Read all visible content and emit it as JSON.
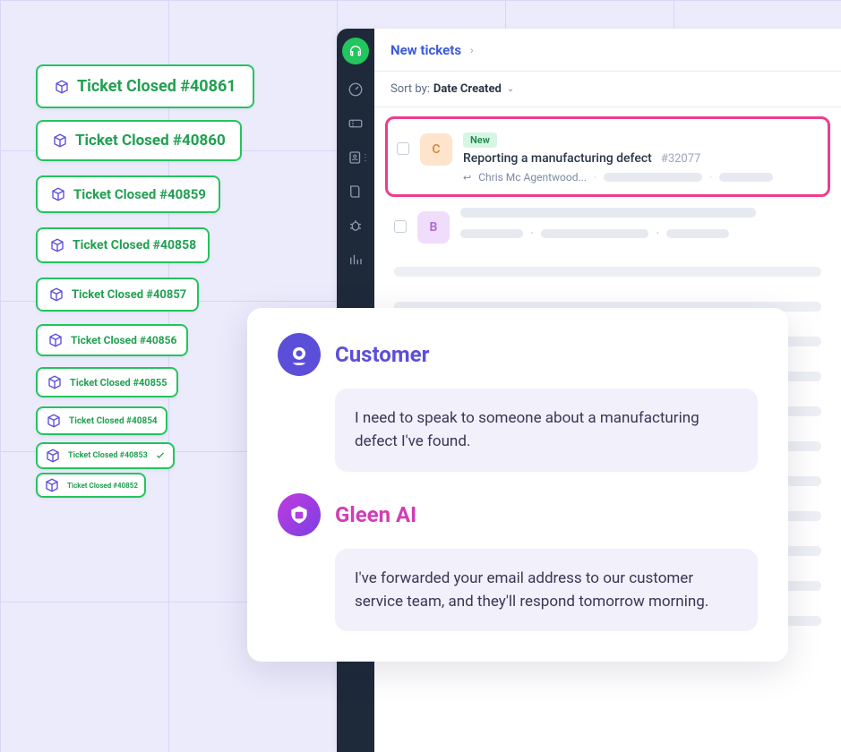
{
  "tickets_closed": [
    {
      "label": "Ticket Closed #40861",
      "show_check": false
    },
    {
      "label": "Ticket Closed #40860",
      "show_check": false
    },
    {
      "label": "Ticket Closed #40859",
      "show_check": false
    },
    {
      "label": "Ticket Closed #40858",
      "show_check": false
    },
    {
      "label": "Ticket Closed #40857",
      "show_check": false
    },
    {
      "label": "Ticket Closed #40856",
      "show_check": false
    },
    {
      "label": "Ticket Closed #40855",
      "show_check": false
    },
    {
      "label": "Ticket Closed #40854",
      "show_check": false
    },
    {
      "label": "Ticket Closed #40853",
      "show_check": true
    },
    {
      "label": "Ticket Closed #40852",
      "show_check": false
    }
  ],
  "app": {
    "header_title": "New tickets",
    "sort_prefix": "Sort by:",
    "sort_value": "Date Created",
    "sidebar_icons": [
      "headset",
      "gauge",
      "ticket",
      "contacts",
      "book",
      "bug",
      "chart"
    ],
    "rows": [
      {
        "avatar_letter": "C",
        "avatar_class": "avatar-c",
        "badge": "New",
        "subject": "Reporting a manufacturing defect",
        "ticket_id": "#32077",
        "from": "Chris Mc Agentwood...",
        "highlighted": true
      },
      {
        "avatar_letter": "B",
        "avatar_class": "avatar-b",
        "highlighted": false
      }
    ]
  },
  "chat": {
    "customer_label": "Customer",
    "customer_message": "I need to speak to someone about a manufacturing defect I've found.",
    "gleen_label": "Gleen AI",
    "gleen_message": "I've forwarded your email address to our customer service team, and they'll respond tomorrow morning."
  },
  "colors": {
    "accent_green": "#22C55E",
    "accent_blue": "#3B5BDB",
    "accent_pink": "#EC3D8F",
    "brand_purple": "#5B4FD9"
  }
}
